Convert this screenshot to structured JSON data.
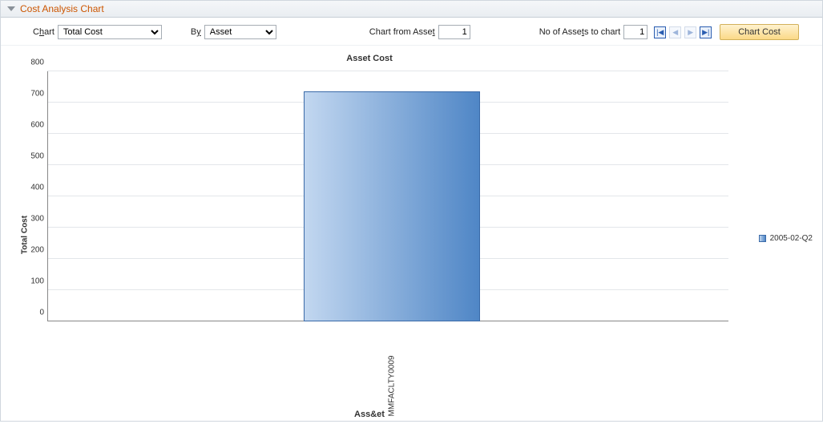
{
  "panel": {
    "title": "Cost Analysis Chart"
  },
  "toolbar": {
    "chart_label_pre": "C",
    "chart_label_u": "h",
    "chart_label_post": "art",
    "chart_value": "Total Cost",
    "by_label_pre": "B",
    "by_label_u": "y",
    "by_label_post": "",
    "by_value": "Asset",
    "from_label_pre": "Chart from Asse",
    "from_label_u": "t",
    "from_label_post": "",
    "from_value": "1",
    "count_label_pre": "No of Asse",
    "count_label_u": "t",
    "count_label_post": "s to chart",
    "count_value": "1",
    "chart_cost_label": "Chart Cost"
  },
  "chart": {
    "title": "Asset Cost",
    "ylabel": "Total Cost",
    "xlabel": "Ass&et",
    "legend_label": "2005-02-Q2",
    "yticks": {
      "t0": "0",
      "t1": "100",
      "t2": "200",
      "t3": "300",
      "t4": "400",
      "t5": "500",
      "t6": "600",
      "t7": "700",
      "t8": "800"
    },
    "xtick0": "MMFACLTY0009"
  },
  "chart_data": {
    "type": "bar",
    "title": "Asset Cost",
    "xlabel": "Ass&et",
    "ylabel": "Total Cost",
    "ylim": [
      0,
      800
    ],
    "categories": [
      "MMFACLTY0009"
    ],
    "series": [
      {
        "name": "2005-02-Q2",
        "values": [
          735
        ]
      }
    ],
    "legend_position": "right",
    "grid": true
  }
}
